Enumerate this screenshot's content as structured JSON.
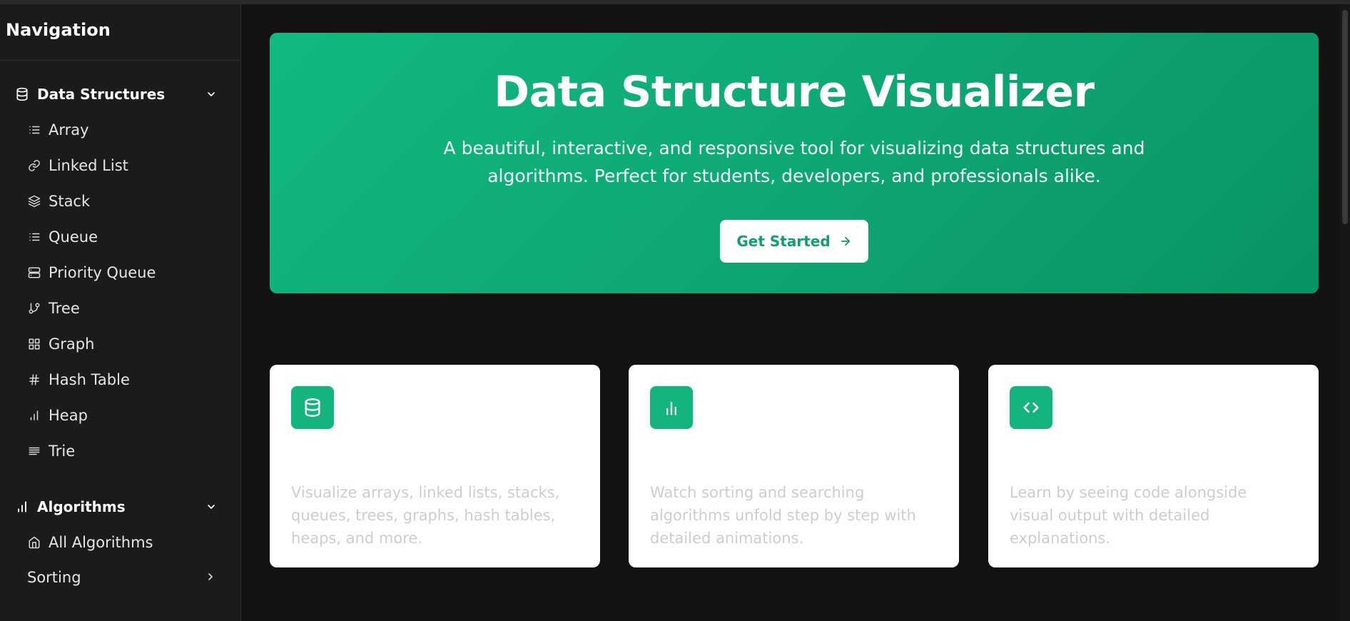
{
  "sidebar": {
    "title": "Navigation",
    "sections": [
      {
        "label": "Data Structures",
        "icon": "database-icon",
        "items": [
          {
            "label": "Array",
            "icon": "list-icon"
          },
          {
            "label": "Linked List",
            "icon": "link-icon"
          },
          {
            "label": "Stack",
            "icon": "layers-icon"
          },
          {
            "label": "Queue",
            "icon": "list-icon"
          },
          {
            "label": "Priority Queue",
            "icon": "server-icon"
          },
          {
            "label": "Tree",
            "icon": "git-branch-icon"
          },
          {
            "label": "Graph",
            "icon": "grid-icon"
          },
          {
            "label": "Hash Table",
            "icon": "hash-icon"
          },
          {
            "label": "Heap",
            "icon": "bar-chart-icon"
          },
          {
            "label": "Trie",
            "icon": "align-left-icon"
          }
        ]
      },
      {
        "label": "Algorithms",
        "icon": "bar-chart-icon",
        "items": [
          {
            "label": "All Algorithms",
            "icon": "home-icon"
          },
          {
            "label": "Sorting",
            "icon": "chevron-right-icon"
          }
        ]
      }
    ]
  },
  "hero": {
    "title": "Data Structure Visualizer",
    "subtitle_line1": "A beautiful, interactive, and responsive tool for visualizing data structures and",
    "subtitle_line2": "algorithms. Perfect for students, developers, and professionals alike.",
    "cta_label": "Get Started",
    "cta_icon": "arrow-right-icon"
  },
  "features": [
    {
      "icon": "database-icon",
      "description": "Visualize arrays, linked lists, stacks, queues, trees, graphs, hash tables, heaps, and more."
    },
    {
      "icon": "bar-chart-icon",
      "description": "Watch sorting and searching algorithms unfold step by step with detailed animations."
    },
    {
      "icon": "code-icon",
      "description": "Learn by seeing code alongside visual output with detailed explanations."
    }
  ],
  "colors": {
    "accent": "#12b981",
    "background": "#121212",
    "sidebar": "#1b1b1b"
  }
}
